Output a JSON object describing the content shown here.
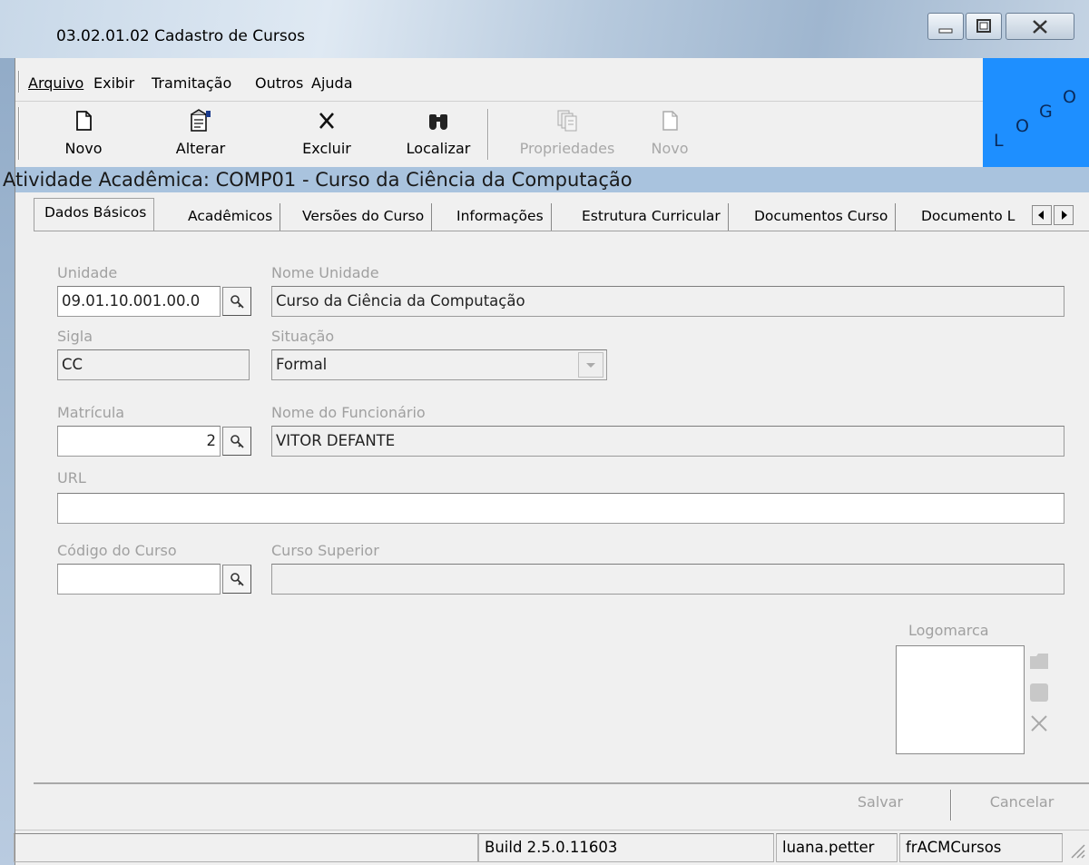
{
  "window": {
    "title": "03.02.01.02 Cadastro de Cursos"
  },
  "menu": [
    {
      "label": "Arquivo",
      "accel_index": 0
    },
    {
      "label": "Exibir",
      "accel_index": 1
    },
    {
      "label": "Tramitação",
      "accel_index": -1
    },
    {
      "label": "Outros",
      "accel_index": -1
    },
    {
      "label": "Ajuda",
      "accel_index": 2
    }
  ],
  "menu_labels": {
    "arquivo": "Arquivo",
    "exibir": "Exibir",
    "tramitacao": "Tramitação",
    "outros": "Outros",
    "ajuda": "Ajuda"
  },
  "toolbar": {
    "novo": "Novo",
    "alterar": "Alterar",
    "excluir": "Excluir",
    "localizar": "Localizar",
    "propriedades": "Propriedades",
    "novo2": "Novo"
  },
  "logo": {
    "letters": [
      "L",
      "O",
      "G",
      "O"
    ]
  },
  "activity_bar": "Atividade Acadêmica: COMP01 - Curso da Ciência da Computação",
  "tabs": {
    "dados_basicos": "Dados Básicos",
    "academicos": "Acadêmicos",
    "versoes": "Versões do Curso",
    "informacoes": "Informações",
    "estrutura": "Estrutura Curricular",
    "documentos": "Documentos Curso",
    "documento_l": "Documento L"
  },
  "form": {
    "unidade_label": "Unidade",
    "unidade_value": "09.01.10.001.00.0",
    "nome_unidade_label": "Nome Unidade",
    "nome_unidade_value": "Curso da Ciência da Computação",
    "sigla_label": "Sigla",
    "sigla_value": "CC",
    "situacao_label": "Situação",
    "situacao_value": "Formal",
    "matricula_label": "Matrícula",
    "matricula_value": "2",
    "nome_funcionario_label": "Nome do Funcionário",
    "nome_funcionario_value": "VITOR DEFANTE",
    "url_label": "URL",
    "url_value": "",
    "codigo_curso_label": "Código do Curso",
    "codigo_curso_value": "",
    "curso_superior_label": "Curso Superior",
    "curso_superior_value": "",
    "logomarca_label": "Logomarca"
  },
  "footer": {
    "salvar": "Salvar",
    "cancelar": "Cancelar"
  },
  "status": {
    "empty": "",
    "build": "Build 2.5.0.11603",
    "user": "luana.petter",
    "form": "frACMCursos"
  },
  "colors": {
    "activity_bar": "#a9c3de",
    "logo_bg": "#1e8fff",
    "disabled_text": "#a0a0a0"
  },
  "icons": {
    "novo": "new-document-icon",
    "alterar": "edit-document-icon",
    "excluir": "x-delete-icon",
    "localizar": "binoculars-icon",
    "propriedades": "properties-icon",
    "search": "magnifier-key-icon"
  }
}
